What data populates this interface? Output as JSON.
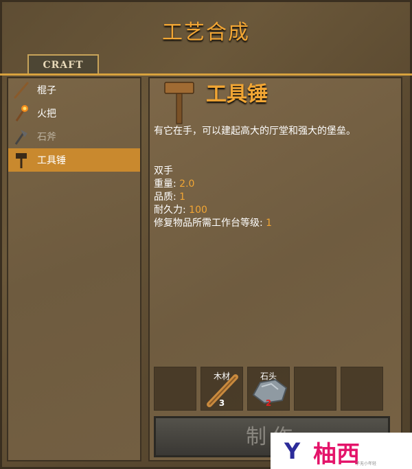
{
  "window": {
    "title": "工艺合成"
  },
  "tabs": [
    {
      "label": "CRAFT"
    }
  ],
  "recipe_list": [
    {
      "label": "棍子",
      "icon": "stick-icon",
      "state": "normal"
    },
    {
      "label": "火把",
      "icon": "torch-icon",
      "state": "normal"
    },
    {
      "label": "石斧",
      "icon": "stone-axe-icon",
      "state": "unavailable"
    },
    {
      "label": "工具锤",
      "icon": "hammer-icon",
      "state": "selected"
    }
  ],
  "detail": {
    "name": "工具锤",
    "icon": "hammer-icon",
    "description": "有它在手，可以建起高大的厅堂和强大的堡垒。",
    "handedness": "双手",
    "weight_label": "重量: ",
    "weight_value": "2.0",
    "quality_label": "品质: ",
    "quality_value": "1",
    "durability_label": "耐久力: ",
    "durability_value": "100",
    "repair_label": "修复物品所需工作台等级: ",
    "repair_value": "1"
  },
  "requirements": [
    {
      "name": "",
      "count": ""
    },
    {
      "name": "木材",
      "count": "3",
      "count_color": "#ffffff",
      "icon": "wood-icon"
    },
    {
      "name": "石头",
      "count": "2",
      "count_color": "#e02020",
      "icon": "stone-icon"
    },
    {
      "name": "",
      "count": ""
    },
    {
      "name": "",
      "count": ""
    }
  ],
  "craft_button": {
    "label": "制作"
  },
  "watermark": {
    "logo": "Y",
    "text": "柚西",
    "sub": "子无小年轻"
  },
  "colors": {
    "accent": "#f2a634",
    "selected_bg": "#c9892e",
    "missing": "#e02020"
  }
}
